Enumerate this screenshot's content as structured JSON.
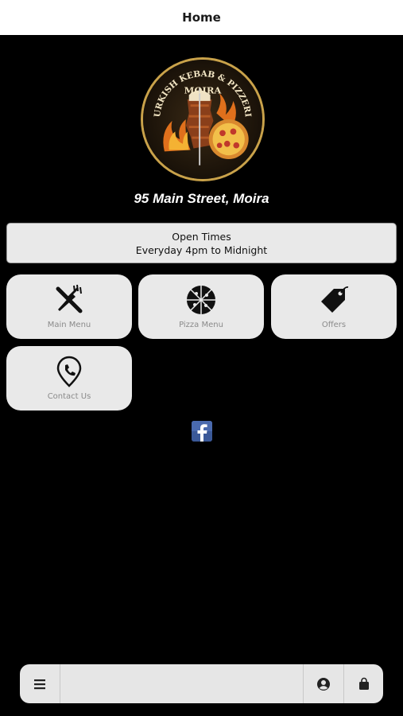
{
  "header": {
    "title": "Home"
  },
  "logo": {
    "text_top": "TURKISH KEBAB & PIZZERIA",
    "text_name": "MOIRA"
  },
  "address": "95 Main Street, Moira",
  "open_times": {
    "title": "Open Times",
    "hours": "Everyday 4pm to Midnight"
  },
  "tiles": [
    {
      "label": "Main Menu",
      "icon": "fork-knife-icon"
    },
    {
      "label": "Pizza Menu",
      "icon": "pizza-icon"
    },
    {
      "label": "Offers",
      "icon": "tag-icon"
    },
    {
      "label": "Contact Us",
      "icon": "location-phone-icon"
    }
  ],
  "social": {
    "icon": "facebook-icon"
  },
  "bottom_bar": {
    "left_icon": "menu-icon",
    "right_icons": [
      "account-icon",
      "bag-icon"
    ]
  },
  "colors": {
    "background": "#000000",
    "tile": "#e9e9e9",
    "facebook": "#3b5998"
  }
}
